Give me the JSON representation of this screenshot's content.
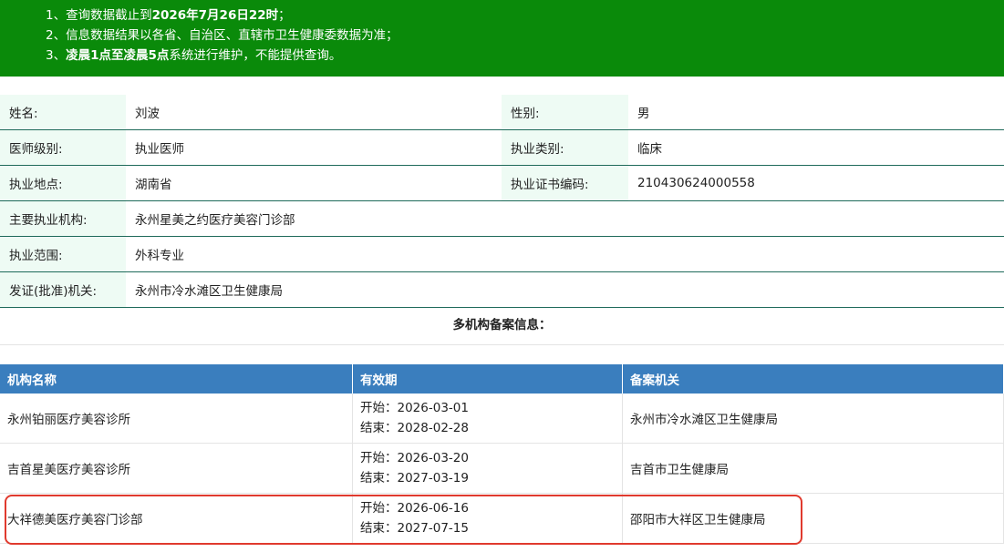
{
  "notice": {
    "line1_prefix": "1、查询数据截止到",
    "line1_bold": "2026年7月26日22时",
    "line1_suffix": "；",
    "line2": "2、信息数据结果以各省、自治区、直辖市卫生健康委数据为准；",
    "line3_prefix": "3、",
    "line3_bold": "凌晨1点至凌晨5点",
    "line3_suffix": "系统进行维护，不能提供查询。"
  },
  "info": {
    "name_label": "姓名:",
    "name_value": "刘波",
    "gender_label": "性别:",
    "gender_value": "男",
    "level_label": "医师级别:",
    "level_value": "执业医师",
    "category_label": "执业类别:",
    "category_value": "临床",
    "location_label": "执业地点:",
    "location_value": "湖南省",
    "cert_label": "执业证书编码:",
    "cert_value": "210430624000558",
    "org_label": "主要执业机构:",
    "org_value": "永州星美之约医疗美容门诊部",
    "scope_label": "执业范围:",
    "scope_value": "外科专业",
    "issuer_label": "发证(批准)机关:",
    "issuer_value": "永州市冷水滩区卫生健康局"
  },
  "multi_title": "多机构备案信息：",
  "table": {
    "headers": [
      "机构名称",
      "有效期",
      "备案机关"
    ],
    "rows": [
      {
        "name": "永州铂丽医疗美容诊所",
        "start": "开始：2026-03-01",
        "end": "结束：2028-02-28",
        "authority": "永州市冷水滩区卫生健康局"
      },
      {
        "name": "吉首星美医疗美容诊所",
        "start": "开始：2026-03-20",
        "end": "结束：2027-03-19",
        "authority": "吉首市卫生健康局"
      },
      {
        "name": "大祥德美医疗美容门诊部",
        "start": "开始：2026-06-16",
        "end": "结束：2027-07-15",
        "authority": "邵阳市大祥区卫生健康局"
      }
    ]
  },
  "colors": {
    "notice_bg": "#0a8a0a",
    "header_bg": "#3a7ebe",
    "highlight": "#e03a2e"
  }
}
